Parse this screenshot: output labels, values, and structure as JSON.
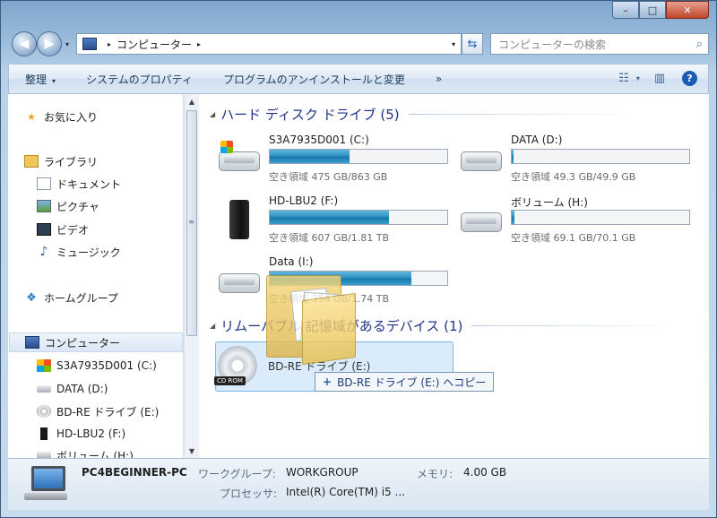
{
  "window": {
    "min": "–",
    "max": "□",
    "close": "✕"
  },
  "nav": {
    "back": "◀",
    "forward": "▶",
    "dropdown": "▾"
  },
  "address": {
    "crumb": "コンピューター",
    "sep": "▸",
    "sep2": "▸",
    "dropdown": "▾"
  },
  "search": {
    "placeholder": "コンピューターの検索"
  },
  "toolbar": {
    "organize": "整理",
    "organize_arrow": "▾",
    "sysprops": "システムのプロパティ",
    "uninstall": "プログラムのアンインストールと変更",
    "more": "»",
    "view_arrow": "▾",
    "help": "?"
  },
  "navpane": {
    "favorites": "お気に入り",
    "libraries": "ライブラリ",
    "documents": "ドキュメント",
    "pictures": "ピクチャ",
    "videos": "ビデオ",
    "music": "ミュージック",
    "homegroup": "ホームグループ",
    "computer": "コンピューター",
    "drive_c": "S3A7935D001 (C:)",
    "drive_d": "DATA (D:)",
    "drive_e": "BD-RE ドライブ (E:)",
    "drive_f": "HD-LBU2 (F:)",
    "drive_h": "ボリューム (H:)"
  },
  "groups": {
    "hdd": "ハード ディスク ドライブ (5)",
    "removable": "リムーバブル 記憶域があるデバイス (1)"
  },
  "drives": [
    {
      "name": "S3A7935D001 (C:)",
      "size": "空き領域 475 GB/863 GB",
      "used": 0.45
    },
    {
      "name": "DATA (D:)",
      "size": "空き領域 49.3 GB/49.9 GB",
      "used": 0.012
    },
    {
      "name": "HD-LBU2 (F:)",
      "size": "空き領域 607 GB/1.81 TB",
      "used": 0.67
    },
    {
      "name": "ボリューム (H:)",
      "size": "空き領域 69.1 GB/70.1 GB",
      "used": 0.014
    },
    {
      "name": "Data (I:)",
      "size": "空き領域 354 GB/1.74 TB",
      "used": 0.8
    }
  ],
  "bd": {
    "name": "BD-RE ドライブ (E:)",
    "label": "CD ROM"
  },
  "drag_tip": {
    "plus": "+",
    "text": "BD-RE ドライブ (E:) へコピー"
  },
  "details": {
    "pc_name": "PC4BEGINNER-PC",
    "wg_label": "ワークグループ:",
    "wg_value": "WORKGROUP",
    "mem_label": "メモリ:",
    "mem_value": "4.00 GB",
    "cpu_label": "プロセッサ:",
    "cpu_value": "Intel(R) Core(TM) i5 ..."
  }
}
